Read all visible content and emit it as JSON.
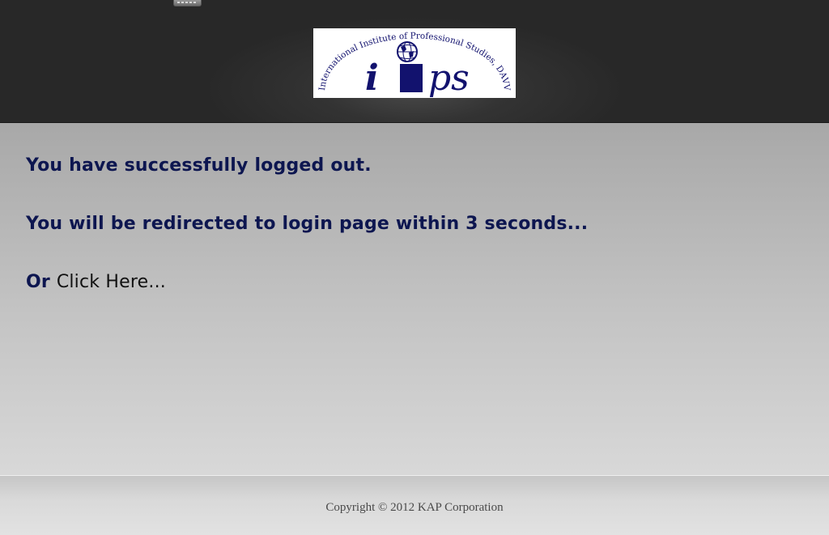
{
  "logo": {
    "arc_text": "International Institute of Professional Studies, DAVV",
    "letter_i": "i",
    "letters_ps": "ps",
    "colors": {
      "navy": "#12126e",
      "background": "#ffffff"
    }
  },
  "message": {
    "logged_out": "You have successfully logged out.",
    "redirect": "You will be redirected to login page within 3 seconds...",
    "or_label": "Or",
    "click_here": "Click Here..."
  },
  "footer": {
    "copyright": "Copyright © 2012 KAP Corporation"
  },
  "colors": {
    "header_bg": "#282828",
    "text_navy": "#0d1650"
  }
}
